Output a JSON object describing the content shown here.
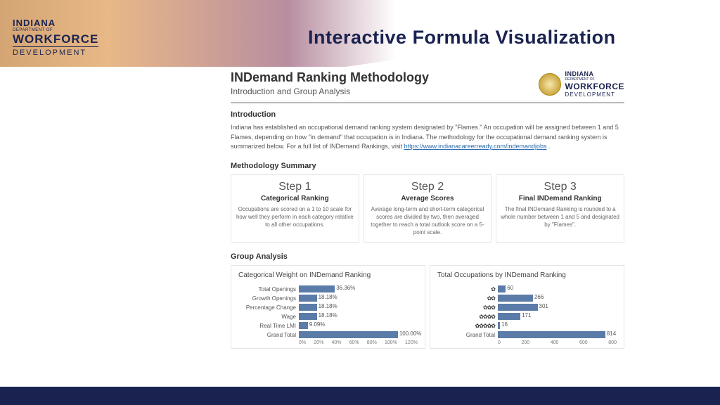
{
  "logo": {
    "l1": "INDIANA",
    "l2": "DEPARTMENT OF",
    "l3": "WORKFORCE",
    "l4": "DEVELOPMENT"
  },
  "page_title": "Interactive Formula Visualization",
  "doc": {
    "title": "INDemand Ranking Methodology",
    "subtitle": "Introduction and Group Analysis"
  },
  "intro": {
    "heading": "Introduction",
    "text_a": "Indiana has established an occupational demand ranking system designated by \"Flames.\" An occupation will be assigned between 1 and 5 Flames, depending on how \"in demand\" that occupation is in Indiana. The methodology for the occupational demand ranking system is summarized below. For a full list of INDemand Rankings, visit ",
    "link": "https://www.indianacareerready.com/indemandjobs",
    "text_b": " ."
  },
  "methodology_heading": "Methodology Summary",
  "steps": [
    {
      "n": "Step 1",
      "t": "Categorical Ranking",
      "d": "Occupations are scored on a 1 to 10 scale for how well they perform in each category relative to all other occupations."
    },
    {
      "n": "Step 2",
      "t": "Average Scores",
      "d": "Average long-term and short-term categorical scores are divided by two, then averaged together to reach a total outlook score on a 5-point scale."
    },
    {
      "n": "Step 3",
      "t": "Final INDemand Ranking",
      "d": "The final INDemand Ranking is rounded to a whole number between 1 and 5 and designated by \"Flames\"."
    }
  ],
  "group_heading": "Group Analysis",
  "chart_data": [
    {
      "type": "bar",
      "title": "Categorical Weight on INDemand Ranking",
      "categories": [
        "Total Openings",
        "Growth Openings",
        "Percentage Change",
        "Wage",
        "Real Time LMI",
        "Grand Total"
      ],
      "values": [
        36.36,
        18.18,
        18.18,
        18.18,
        9.09,
        100.0
      ],
      "labels": [
        "36.36%",
        "18.18%",
        "18.18%",
        "18.18%",
        "9.09%",
        "100.00%"
      ],
      "xlim": [
        0,
        120
      ],
      "xticks": [
        "0%",
        "20%",
        "40%",
        "60%",
        "80%",
        "100%",
        "120%"
      ]
    },
    {
      "type": "bar",
      "title": "Total Occupations by INDemand Ranking",
      "categories": [
        "1",
        "2",
        "3",
        "4",
        "5",
        "Grand Total"
      ],
      "flame_labels": [
        "✿",
        "✿✿",
        "✿✿✿",
        "✿✿✿✿",
        "✿✿✿✿✿",
        "Grand Total"
      ],
      "values": [
        60,
        266,
        301,
        171,
        16,
        814
      ],
      "labels": [
        "60",
        "266",
        "301",
        "171",
        "16",
        "814"
      ],
      "xlim": [
        0,
        900
      ],
      "xticks": [
        "0",
        "200",
        "400",
        "600",
        "800"
      ]
    }
  ]
}
